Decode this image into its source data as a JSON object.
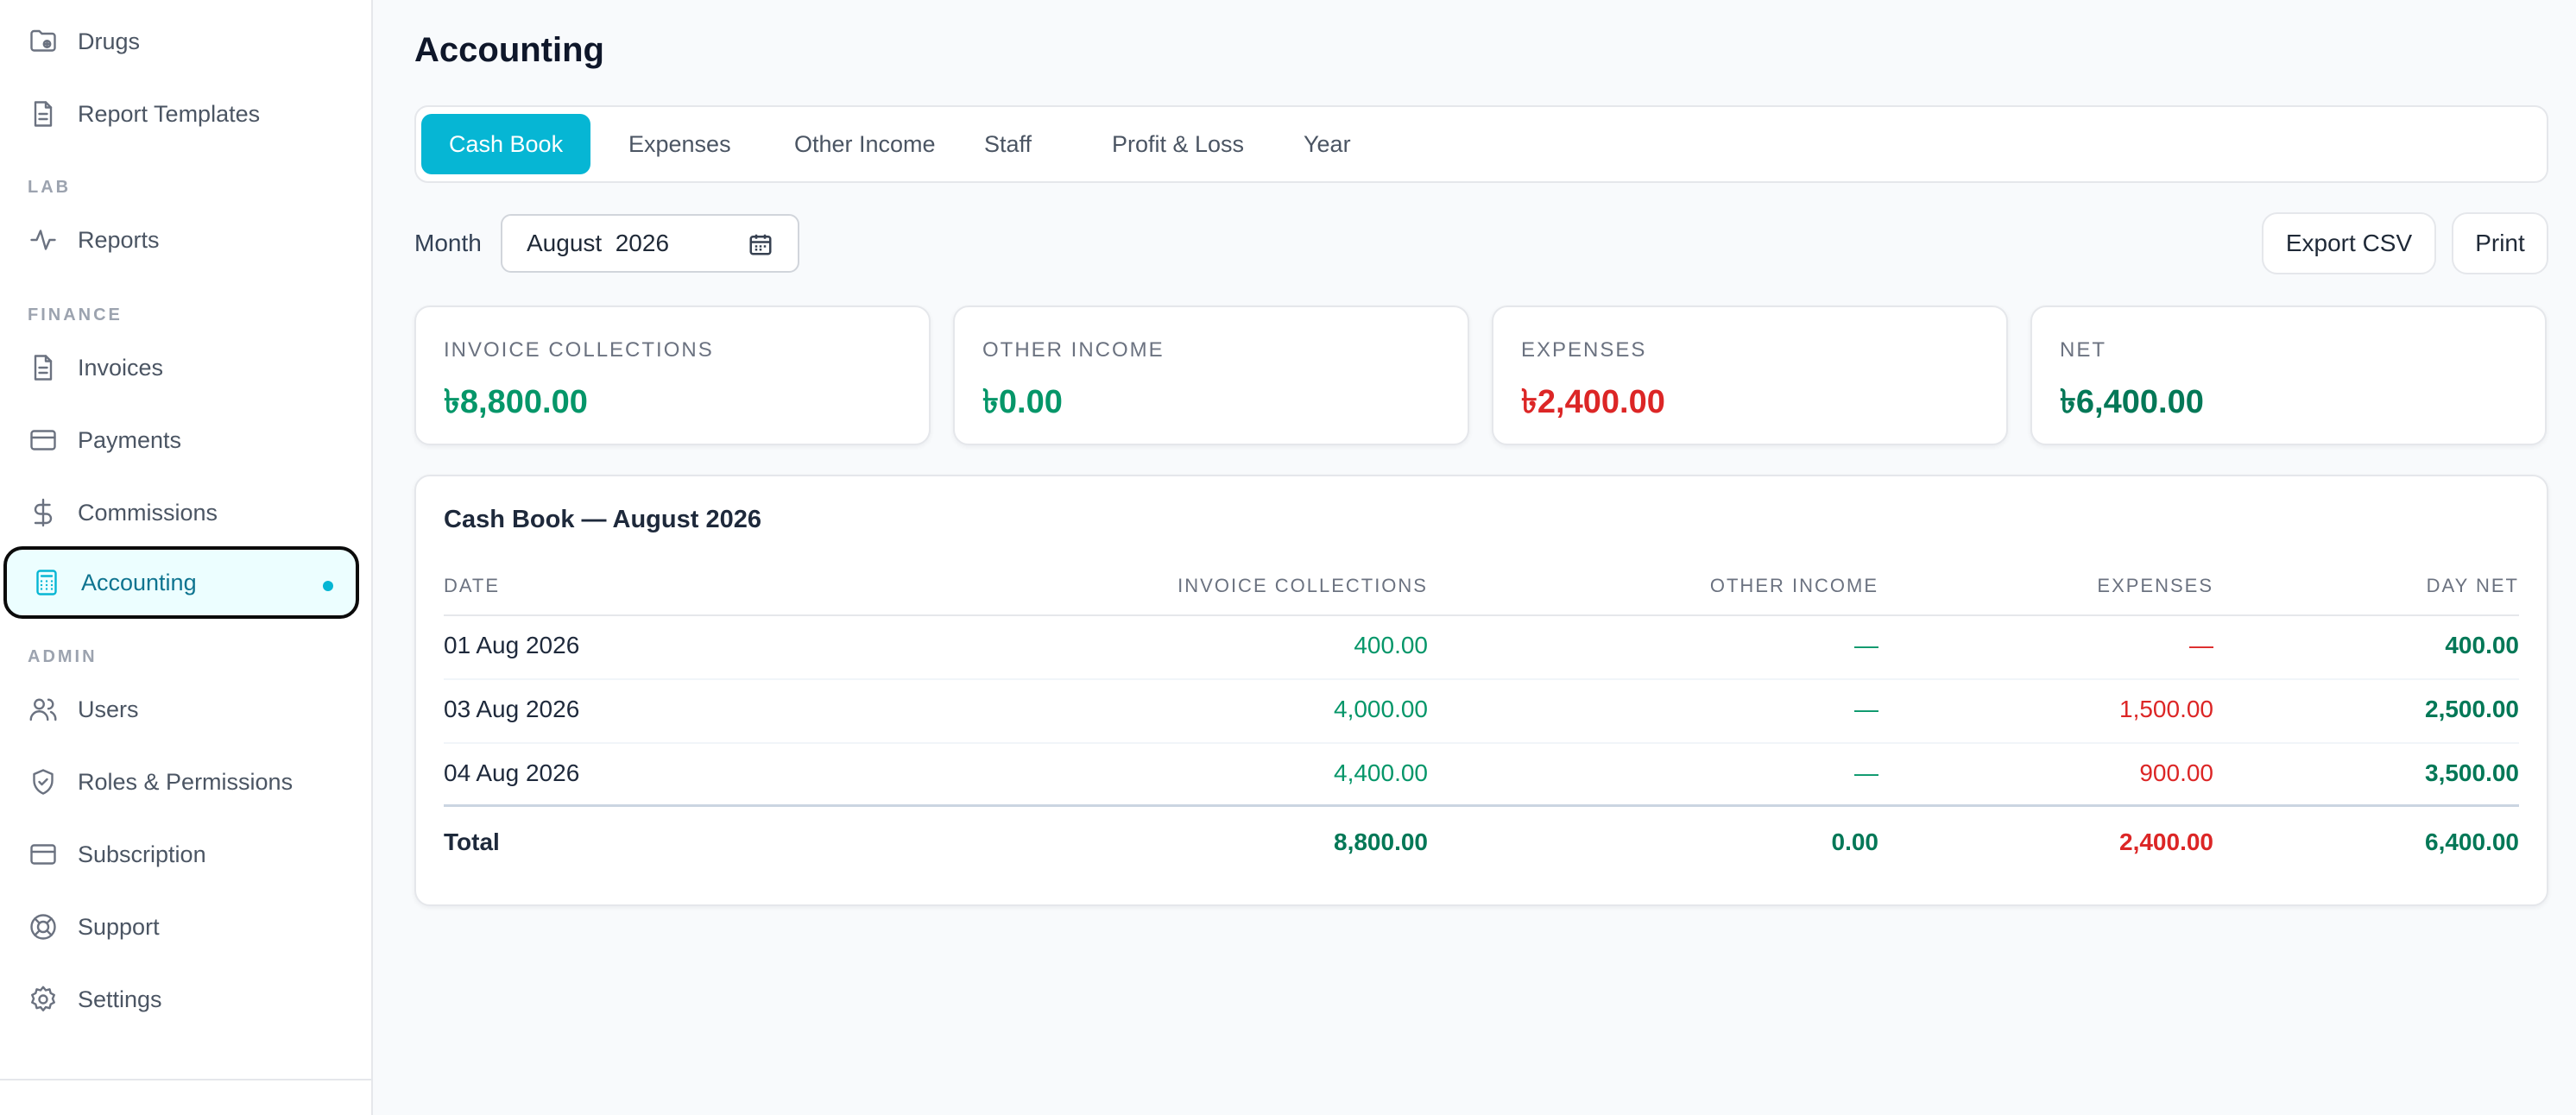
{
  "sidebar": {
    "items_top": [
      {
        "label": "Drugs",
        "icon": "folder-icon"
      },
      {
        "label": "Report Templates",
        "icon": "document-icon"
      }
    ],
    "section_lab": "LAB",
    "lab_items": [
      {
        "label": "Reports",
        "icon": "activity-icon"
      }
    ],
    "section_finance": "FINANCE",
    "finance_items": [
      {
        "label": "Invoices",
        "icon": "document-icon"
      },
      {
        "label": "Payments",
        "icon": "credit-card-icon"
      },
      {
        "label": "Commissions",
        "icon": "dollar-icon"
      },
      {
        "label": "Accounting",
        "icon": "calculator-icon",
        "active": true
      }
    ],
    "section_admin": "ADMIN",
    "admin_items": [
      {
        "label": "Users",
        "icon": "users-icon"
      },
      {
        "label": "Roles & Permissions",
        "icon": "shield-icon"
      },
      {
        "label": "Subscription",
        "icon": "credit-card-icon"
      },
      {
        "label": "Support",
        "icon": "lifebuoy-icon"
      },
      {
        "label": "Settings",
        "icon": "gear-icon"
      }
    ]
  },
  "page": {
    "title": "Accounting"
  },
  "tabs": [
    {
      "label": "Cash Book",
      "active": true
    },
    {
      "label": "Expenses"
    },
    {
      "label": "Other Income"
    },
    {
      "label": "Staff"
    },
    {
      "label": "Profit & Loss"
    },
    {
      "label": "Year"
    }
  ],
  "filter": {
    "month_label": "Month",
    "month_value": "August  2026"
  },
  "actions": {
    "export": "Export CSV",
    "print": "Print"
  },
  "summary": [
    {
      "label": "INVOICE COLLECTIONS",
      "value": "৳8,800.00",
      "color": "#059669"
    },
    {
      "label": "OTHER INCOME",
      "value": "৳0.00",
      "color": "#059669"
    },
    {
      "label": "EXPENSES",
      "value": "৳2,400.00",
      "color": "#dc2626"
    },
    {
      "label": "NET",
      "value": "৳6,400.00",
      "color": "#047857"
    }
  ],
  "cashbook": {
    "title": "Cash Book — August 2026",
    "columns": [
      "DATE",
      "INVOICE COLLECTIONS",
      "OTHER INCOME",
      "EXPENSES",
      "DAY NET"
    ],
    "rows": [
      {
        "date": "01 Aug 2026",
        "invoice": "400.00",
        "other": "—",
        "expenses": "—",
        "net": "400.00"
      },
      {
        "date": "03 Aug 2026",
        "invoice": "4,000.00",
        "other": "—",
        "expenses": "1,500.00",
        "net": "2,500.00"
      },
      {
        "date": "04 Aug 2026",
        "invoice": "4,400.00",
        "other": "—",
        "expenses": "900.00",
        "net": "3,500.00"
      }
    ],
    "total": {
      "label": "Total",
      "invoice": "8,800.00",
      "other": "0.00",
      "expenses": "2,400.00",
      "net": "6,400.00"
    }
  },
  "colors": {
    "accent": "#06b6d4",
    "positive": "#059669",
    "positive_dark": "#047857",
    "negative": "#dc2626"
  }
}
